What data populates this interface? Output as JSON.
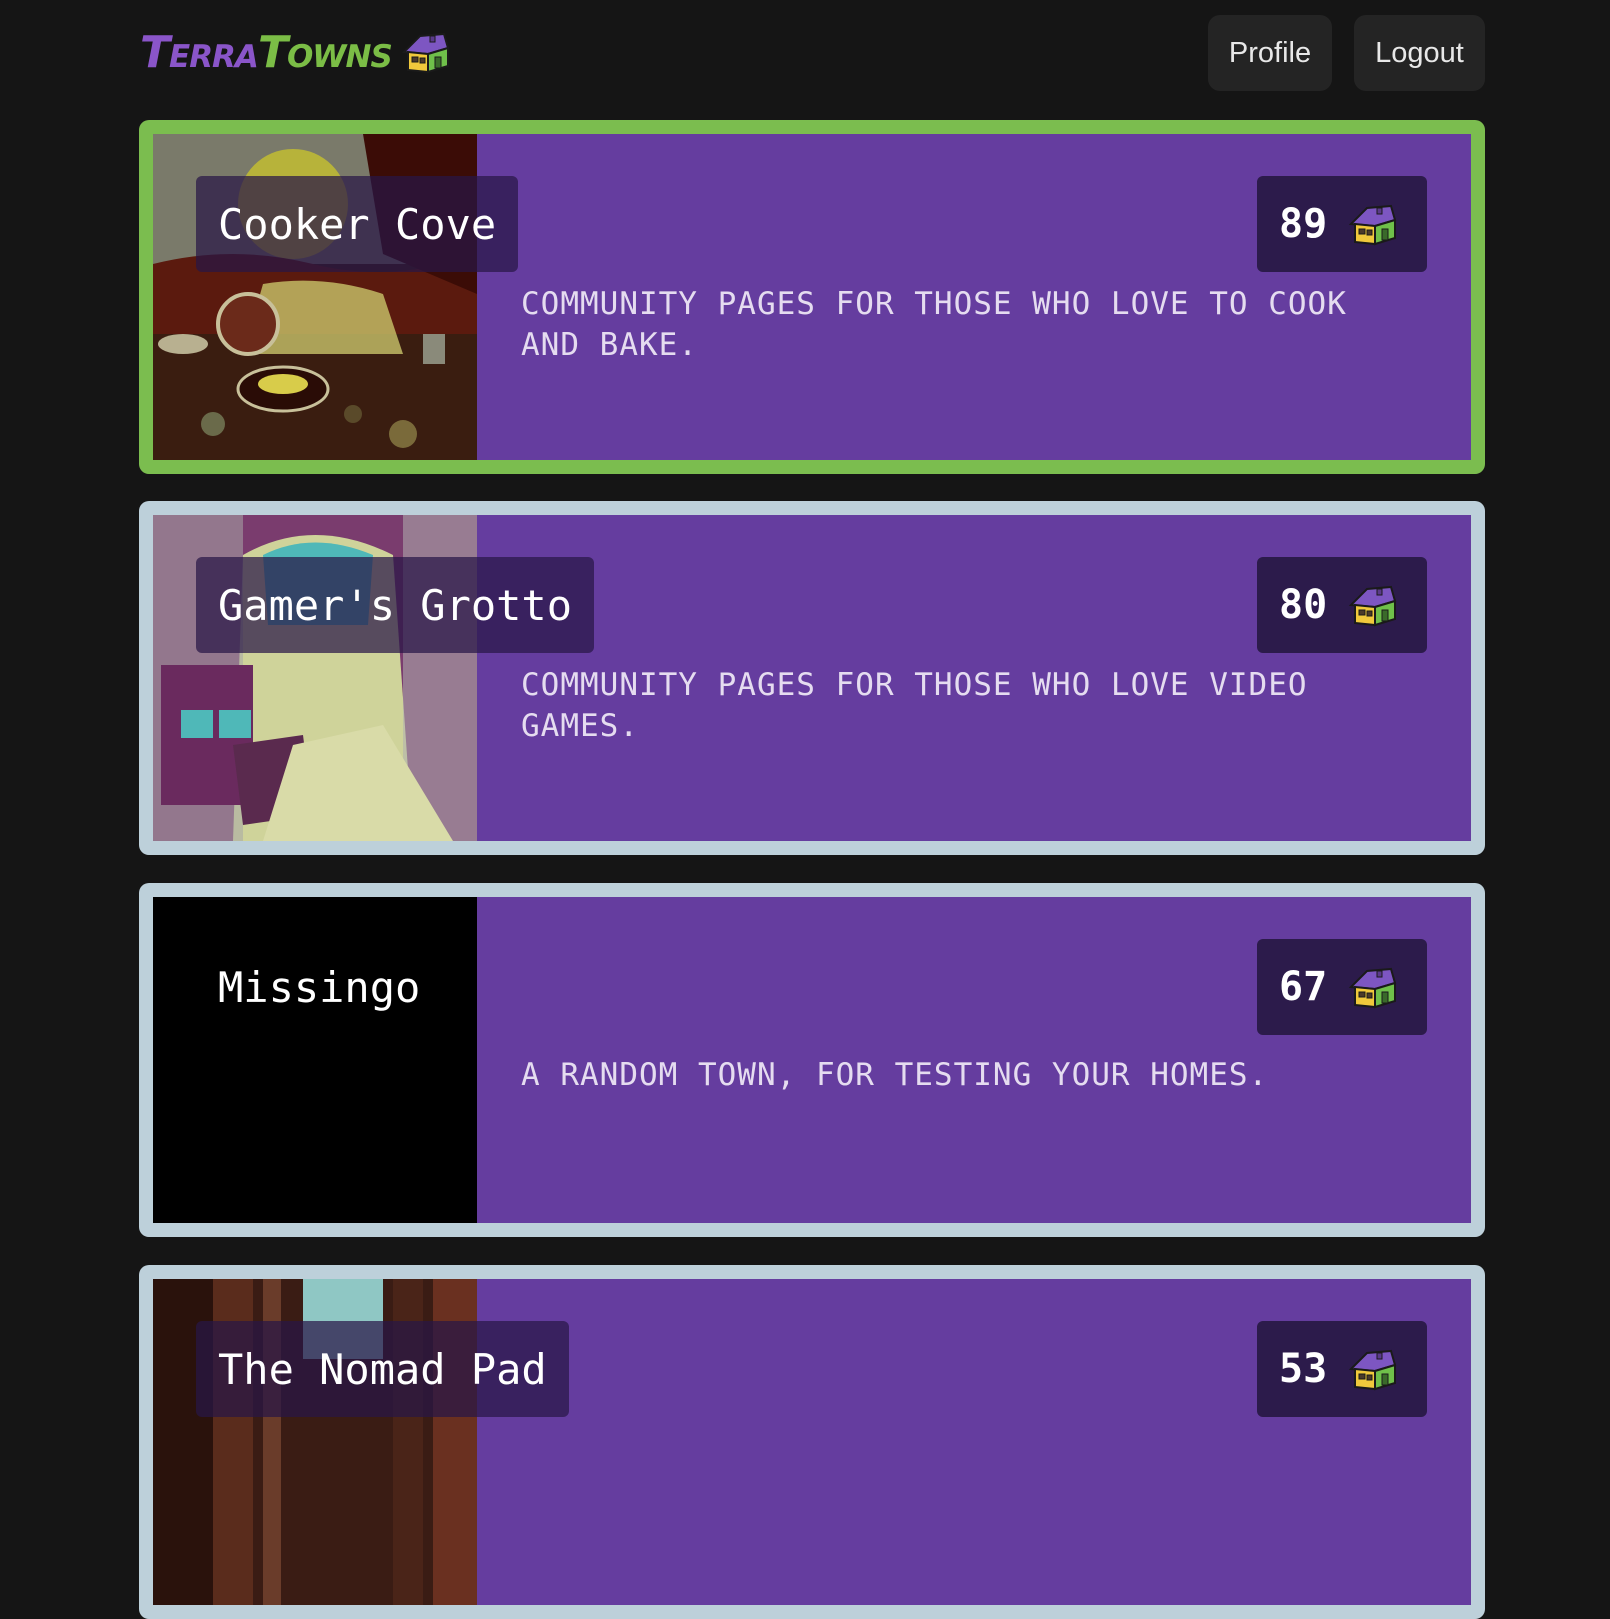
{
  "app": {
    "logo_terra": "Terra",
    "logo_towns": "Towns"
  },
  "nav": {
    "profile_label": "Profile",
    "logout_label": "Logout"
  },
  "towns": [
    {
      "name": "Cooker Cove",
      "count": "89",
      "description": "Community pages for those who love to cook and bake.",
      "selected": true
    },
    {
      "name": "Gamer's Grotto",
      "count": "80",
      "description": "Community pages for those who love video games.",
      "selected": false
    },
    {
      "name": "Missingo",
      "count": "67",
      "description": "A random town, for testing your homes.",
      "selected": false
    },
    {
      "name": "The Nomad Pad",
      "count": "53",
      "description": "",
      "selected": false
    }
  ],
  "colors": {
    "background": "#151515",
    "card_fill": "#653d9f",
    "selected_border": "#7bbd4f",
    "card_border": "#bdd0da",
    "badge": "#2c1b4b"
  },
  "icons": [
    "house-icon"
  ]
}
